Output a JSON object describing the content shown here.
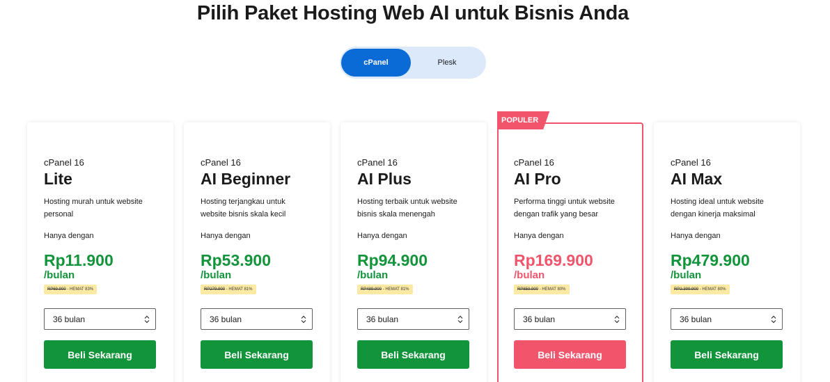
{
  "header": {
    "title": "Pilih Paket Hosting Web AI untuk Bisnis Anda"
  },
  "toggle": {
    "options": [
      "cPanel",
      "Plesk"
    ],
    "active": "cPanel"
  },
  "colors": {
    "accent_green": "#12943b",
    "accent_pink": "#f0556c",
    "toggle_blue": "#0a6ad6"
  },
  "popular_label": "POPULER",
  "plans": [
    {
      "sub": "cPanel 16",
      "name": "Lite",
      "desc": "Hosting murah untuk website personal",
      "only": "Hanya dengan",
      "price": "Rp11.900",
      "per": "/bulan",
      "old_price": "RP69.900",
      "save": " - HEMAT 83%",
      "duration": "36 bulan",
      "button": "Beli Sekarang"
    },
    {
      "sub": "cPanel 16",
      "name": "AI Beginner",
      "desc": "Hosting terjangkau untuk website bisnis skala kecil",
      "only": "Hanya dengan",
      "price": "Rp53.900",
      "per": "/bulan",
      "old_price": "RP279.900",
      "save": " - HEMAT 81%",
      "duration": "36 bulan",
      "button": "Beli Sekarang"
    },
    {
      "sub": "cPanel 16",
      "name": "AI Plus",
      "desc": "Hosting terbaik untuk website bisnis skala menengah",
      "only": "Hanya dengan",
      "price": "Rp94.900",
      "per": "/bulan",
      "old_price": "RP489.900",
      "save": " - HEMAT 81%",
      "duration": "36 bulan",
      "button": "Beli Sekarang"
    },
    {
      "sub": "cPanel 16",
      "name": "AI Pro",
      "desc": "Performa tinggi untuk website dengan trafik yang besar",
      "only": "Hanya dengan",
      "price": "Rp169.900",
      "per": "/bulan",
      "old_price": "RP859.900",
      "save": " - HEMAT 80%",
      "duration": "36 bulan",
      "button": "Beli Sekarang"
    },
    {
      "sub": "cPanel 16",
      "name": "AI Max",
      "desc": "Hosting ideal untuk website dengan kinerja maksimal",
      "only": "Hanya dengan",
      "price": "Rp479.900",
      "per": "/bulan",
      "old_price": "RP2.399.900",
      "save": " - HEMAT 80%",
      "duration": "36 bulan",
      "button": "Beli Sekarang"
    }
  ]
}
